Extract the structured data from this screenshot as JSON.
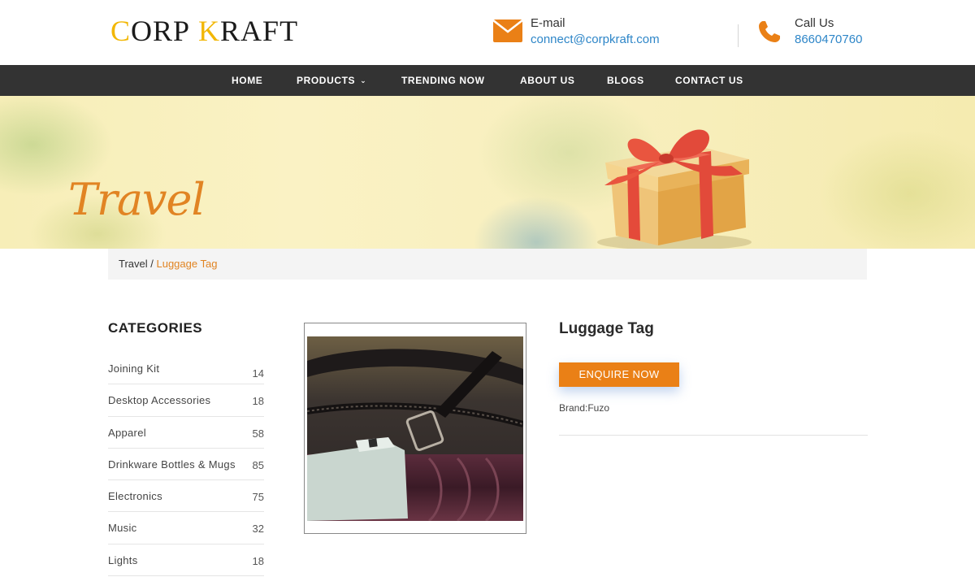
{
  "header": {
    "logo_text": "CORP KRAFT",
    "email": {
      "label": "E-mail",
      "value": "connect@corpkraft.com"
    },
    "phone": {
      "label": "Call Us",
      "value": "8660470760"
    },
    "accent_color": "#ea8016",
    "link_color": "#2e86c8"
  },
  "nav": {
    "items": [
      {
        "label": "HOME"
      },
      {
        "label": "PRODUCTS"
      },
      {
        "label": "TRENDING NOW"
      },
      {
        "label": "ABOUT US"
      },
      {
        "label": "BLOGS"
      },
      {
        "label": "CONTACT US"
      }
    ],
    "products_icon": "chevron-down-icon"
  },
  "banner": {
    "title": "Travel"
  },
  "breadcrumb": {
    "parent": "Travel",
    "separator": " / ",
    "current": "Luggage Tag"
  },
  "sidebar": {
    "title": "CATEGORIES",
    "items": [
      {
        "name": "Joining Kit",
        "count": "14"
      },
      {
        "name": "Desktop Accessories",
        "count": "18"
      },
      {
        "name": "Apparel",
        "count": "58"
      },
      {
        "name": "Drinkware Bottles & Mugs",
        "count": "85"
      },
      {
        "name": "Electronics",
        "count": "75"
      },
      {
        "name": "Music",
        "count": "32"
      },
      {
        "name": "Lights",
        "count": "18"
      }
    ]
  },
  "product": {
    "title": "Luggage Tag",
    "enquire_label": "ENQUIRE NOW",
    "brand": "Brand:Fuzo"
  }
}
